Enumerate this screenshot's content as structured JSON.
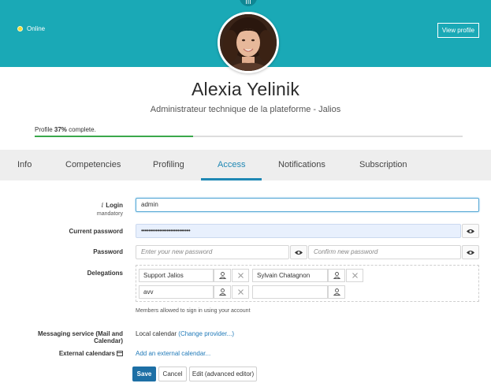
{
  "header": {
    "status": "Online",
    "view_profile": "View profile",
    "top_icon": "III",
    "accent_color": "#1aa9b6"
  },
  "profile": {
    "name": "Alexia Yelinik",
    "role": "Administrateur technique de la plateforme - Jalios",
    "progress_prefix": "Profile ",
    "progress_percent_label": "37%",
    "progress_suffix": " complete.",
    "progress_fraction": 0.37
  },
  "tabs": [
    {
      "label": "Info"
    },
    {
      "label": "Competencies"
    },
    {
      "label": "Profiling"
    },
    {
      "label": "Access",
      "active": true
    },
    {
      "label": "Notifications"
    },
    {
      "label": "Subscription"
    }
  ],
  "form": {
    "login": {
      "label": "Login",
      "sublabel": "mandatory",
      "value": "admin",
      "info_icon": "i"
    },
    "current_password": {
      "label": "Current password",
      "value": "•••••••••••••••••••••••••••"
    },
    "password": {
      "label": "Password",
      "placeholder_new": "Enter your new password",
      "placeholder_confirm": "Confirm new password"
    },
    "delegations": {
      "label": "Delegations",
      "entries": [
        "Support Jalios",
        "Sylvain Chatagnon",
        "avv",
        ""
      ],
      "helper": "Members allowed to sign in using your account"
    },
    "messaging": {
      "label": "Messaging service (Mail and Calendar)",
      "value": "Local calendar",
      "link": "(Change provider...)"
    },
    "external_calendars": {
      "label": "External calendars",
      "link": "Add an external calendar..."
    }
  },
  "actions": {
    "save": "Save",
    "cancel": "Cancel",
    "edit_advanced": "Edit (advanced editor)"
  }
}
